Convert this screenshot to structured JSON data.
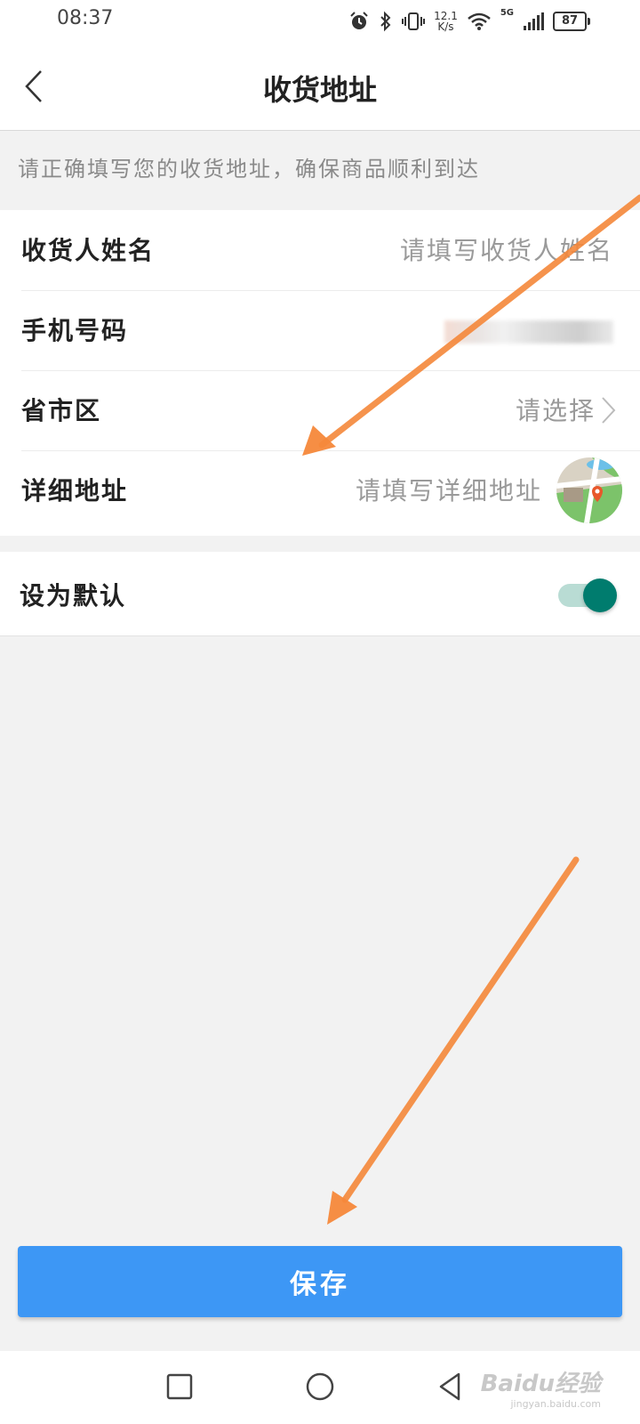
{
  "status_bar": {
    "time": "08:37",
    "speed_value": "12.1",
    "speed_unit": "K/s",
    "network": "5G",
    "battery": "87"
  },
  "header": {
    "title": "收货地址",
    "back_icon": "chevron-left-icon"
  },
  "hint": "请正确填写您的收货地址，确保商品顺利到达",
  "form": {
    "rows": [
      {
        "label": "收货人姓名",
        "placeholder": "请填写收货人姓名"
      },
      {
        "label": "手机号码",
        "value": ""
      },
      {
        "label": "省市区",
        "placeholder": "请选择"
      },
      {
        "label": "详细地址",
        "placeholder": "请填写详细地址",
        "icon": "map-location-icon"
      }
    ]
  },
  "default_setting": {
    "label": "设为默认",
    "enabled": true
  },
  "save_button": {
    "label": "保存"
  },
  "system_nav": {
    "icons": [
      "square-recents-icon",
      "circle-home-icon",
      "triangle-back-icon"
    ]
  },
  "watermark": {
    "main": "Baidu经验",
    "sub": "jingyan.baidu.com"
  },
  "colors": {
    "accent_blue": "#3d97f5",
    "toggle_on": "#007c6e",
    "annotation_arrow": "#f5883a"
  }
}
